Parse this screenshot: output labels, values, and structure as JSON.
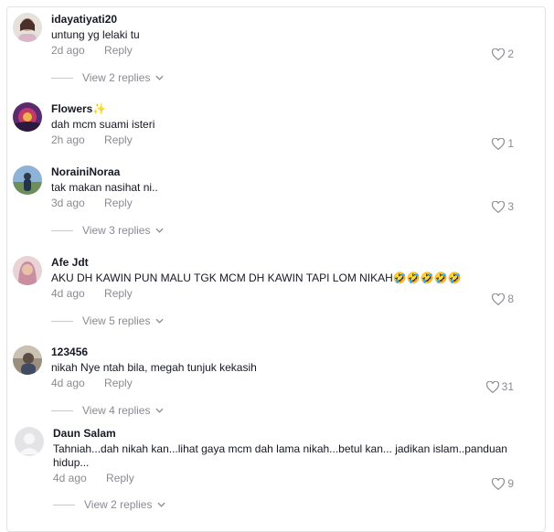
{
  "comments": [
    {
      "username": "idayatiyati20",
      "text": "untung yg lelaki tu",
      "time": "2d ago",
      "reply": "Reply",
      "likes": "2",
      "view_replies": "View 2 replies"
    },
    {
      "username": "Flowers✨",
      "text": "dah mcm suami isteri",
      "time": "2h ago",
      "reply": "Reply",
      "likes": "1"
    },
    {
      "username": "NorainiNoraa",
      "text": "tak makan nasihat ni..",
      "time": "3d ago",
      "reply": "Reply",
      "likes": "3",
      "view_replies": "View 3 replies"
    },
    {
      "username": "Afe Jdt",
      "text": "AKU DH KAWIN PUN MALU TGK MCM DH KAWIN TAPI LOM NIKAH",
      "emojis": "🤣🤣🤣🤣🤣",
      "time": "4d ago",
      "reply": "Reply",
      "likes": "8",
      "view_replies": "View 5 replies"
    },
    {
      "username": "123456",
      "text": "nikah Nye ntah bila, megah tunjuk kekasih",
      "time": "4d ago",
      "reply": "Reply",
      "likes": "31",
      "view_replies": "View 4 replies"
    },
    {
      "username": "Daun Salam",
      "text": "Tahniah...dah nikah kan...lihat gaya mcm dah lama nikah...betul kan... jadikan islam..panduan hidup...",
      "time": "4d ago",
      "reply": "Reply",
      "likes": "9",
      "view_replies": "View 2 replies"
    }
  ],
  "icons": {
    "like": "heart-outline-icon",
    "expand": "chevron-down-icon"
  },
  "colors": {
    "text": "#161823",
    "muted": "#8a8b91",
    "border": "#e3e3e4"
  }
}
